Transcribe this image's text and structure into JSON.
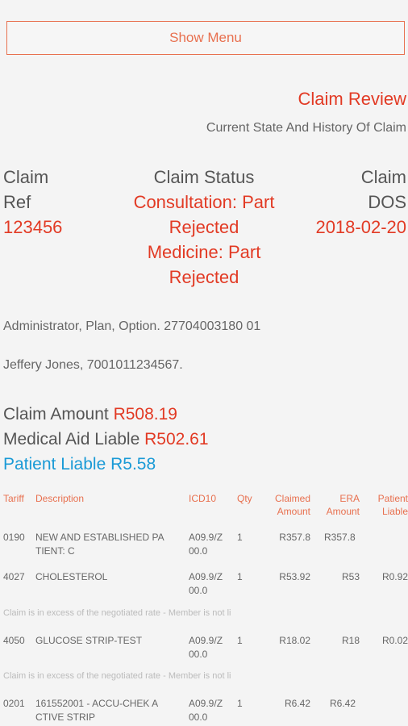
{
  "menu": {
    "show_menu_label": "Show Menu"
  },
  "header": {
    "title": "Claim Review",
    "subtitle": "Current State And History Of Claim"
  },
  "summary": {
    "ref_label_1": "Claim",
    "ref_label_2": "Ref",
    "ref_value": "123456",
    "status_label": "Claim Status",
    "status_lines": [
      "Consultation: Part",
      "Rejected",
      "Medicine: Part",
      "Rejected"
    ],
    "dos_label_1": "Claim",
    "dos_label_2": "DOS",
    "dos_value": "2018-02-20"
  },
  "admin_line": "Administrator, Plan, Option. 27704003180 01",
  "patient_line": "Jeffery Jones, 7001011234567.",
  "amounts": {
    "claim_label": "Claim Amount",
    "claim_value": "R508.19",
    "medical_label": "Medical Aid Liable",
    "medical_value": "R502.61",
    "patient_label": "Patient Liable",
    "patient_value": "R5.58"
  },
  "table": {
    "headers": {
      "tariff": "Tariff",
      "description": "Description",
      "icd10": "ICD10",
      "qty": "Qty",
      "claimed_1": "Claimed",
      "claimed_2": "Amount",
      "era_1": "ERA",
      "era_2": "Amount",
      "patient_1": "Patient",
      "patient_2": "Liable"
    },
    "rows": [
      {
        "tariff": "0190",
        "desc_1": "NEW AND ESTABLISHED PA",
        "desc_2": "TIENT: C",
        "icd_1": "A09.9/Z",
        "icd_2": "00.0",
        "qty": "1",
        "claimed": "R357.8",
        "era": "R357.8",
        "patient": ""
      },
      {
        "tariff": "4027",
        "desc_1": "CHOLESTEROL",
        "desc_2": "",
        "icd_1": "A09.9/Z",
        "icd_2": "00.0",
        "qty": "1",
        "claimed": "R53.92",
        "era": "R53",
        "patient": "R0.92"
      },
      {
        "tariff": "4050",
        "desc_1": "GLUCOSE STRIP-TEST",
        "desc_2": "",
        "icd_1": "A09.9/Z",
        "icd_2": "00.0",
        "qty": "1",
        "claimed": "R18.02",
        "era": "R18",
        "patient": "R0.02"
      },
      {
        "tariff": "0201",
        "desc_1": "161552001 - ACCU-CHEK A",
        "desc_2": "CTIVE STRIP",
        "icd_1": "A09.9/Z",
        "icd_2": "00.0",
        "qty": "1",
        "claimed": "R6.42",
        "era": "R6.42",
        "patient": ""
      }
    ],
    "notes": [
      "Claim is in excess of the negotiated rate - Member is not li",
      "Claim is in excess of the negotiated rate - Member is not li"
    ]
  }
}
